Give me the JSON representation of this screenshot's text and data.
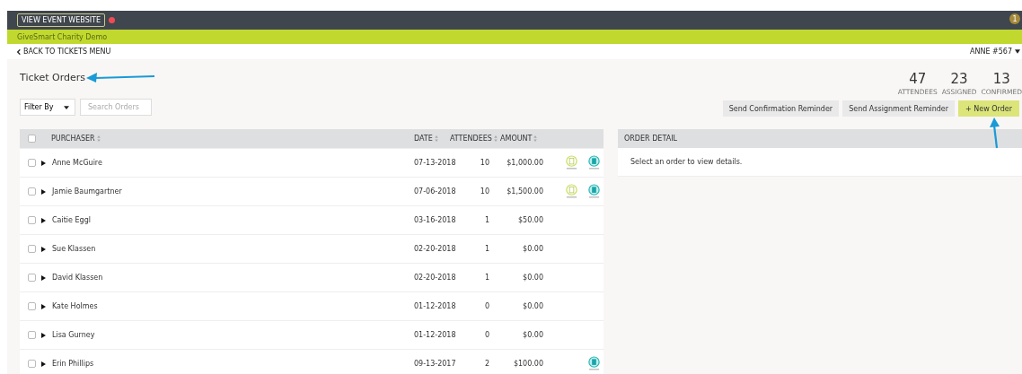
{
  "header": {
    "website_button": "VIEW EVENT WEBSITE",
    "alert_dot": true,
    "notification_count": "1"
  },
  "event_bar": {
    "title": "GiveSmart Charity Demo"
  },
  "nav": {
    "back_link": "BACK TO TICKETS MENU",
    "user_menu": "ANNE #567"
  },
  "page": {
    "title": "Ticket Orders"
  },
  "stats": [
    {
      "value": "47",
      "label": "ATTENDEES"
    },
    {
      "value": "23",
      "label": "ASSIGNED"
    },
    {
      "value": "13",
      "label": "CONFIRMED"
    }
  ],
  "filter": {
    "label": "Filter By",
    "search_placeholder": "Search Orders"
  },
  "actions": [
    {
      "label": "Send Confirmation Reminder",
      "kind": "secondary"
    },
    {
      "label": "Send Assignment Reminder",
      "kind": "secondary"
    },
    {
      "label": "+ New Order",
      "kind": "primary"
    }
  ],
  "table": {
    "select_all_checked": false,
    "columns": [
      "PURCHASER",
      "DATE",
      "ATTENDEES",
      "AMOUNT"
    ],
    "rows": [
      {
        "purchaser": "Anne McGuire",
        "date": "07-13-2018",
        "attendees": "10",
        "amount": "$1,000.00",
        "checked": false,
        "unassigned_badge": true,
        "confirmed_badge": true
      },
      {
        "purchaser": "Jamie Baumgartner",
        "date": "07-06-2018",
        "attendees": "10",
        "amount": "$1,500.00",
        "checked": false,
        "unassigned_badge": true,
        "confirmed_badge": true
      },
      {
        "purchaser": "Caitie Eggl",
        "date": "03-16-2018",
        "attendees": "1",
        "amount": "$50.00",
        "checked": false,
        "unassigned_badge": false,
        "confirmed_badge": false
      },
      {
        "purchaser": "Sue Klassen",
        "date": "02-20-2018",
        "attendees": "1",
        "amount": "$0.00",
        "checked": false,
        "unassigned_badge": false,
        "confirmed_badge": false
      },
      {
        "purchaser": "David Klassen",
        "date": "02-20-2018",
        "attendees": "1",
        "amount": "$0.00",
        "checked": false,
        "unassigned_badge": false,
        "confirmed_badge": false
      },
      {
        "purchaser": "Kate Holmes",
        "date": "01-12-2018",
        "attendees": "0",
        "amount": "$0.00",
        "checked": false,
        "unassigned_badge": false,
        "confirmed_badge": false
      },
      {
        "purchaser": "Lisa Gurney",
        "date": "01-12-2018",
        "attendees": "0",
        "amount": "$0.00",
        "checked": false,
        "unassigned_badge": false,
        "confirmed_badge": false
      },
      {
        "purchaser": "Erin Phillips",
        "date": "09-13-2017",
        "attendees": "2",
        "amount": "$100.00",
        "checked": false,
        "unassigned_badge": false,
        "confirmed_badge": true
      }
    ]
  },
  "order_detail": {
    "title": "ORDER DETAIL",
    "message": "Select an order to view details."
  }
}
